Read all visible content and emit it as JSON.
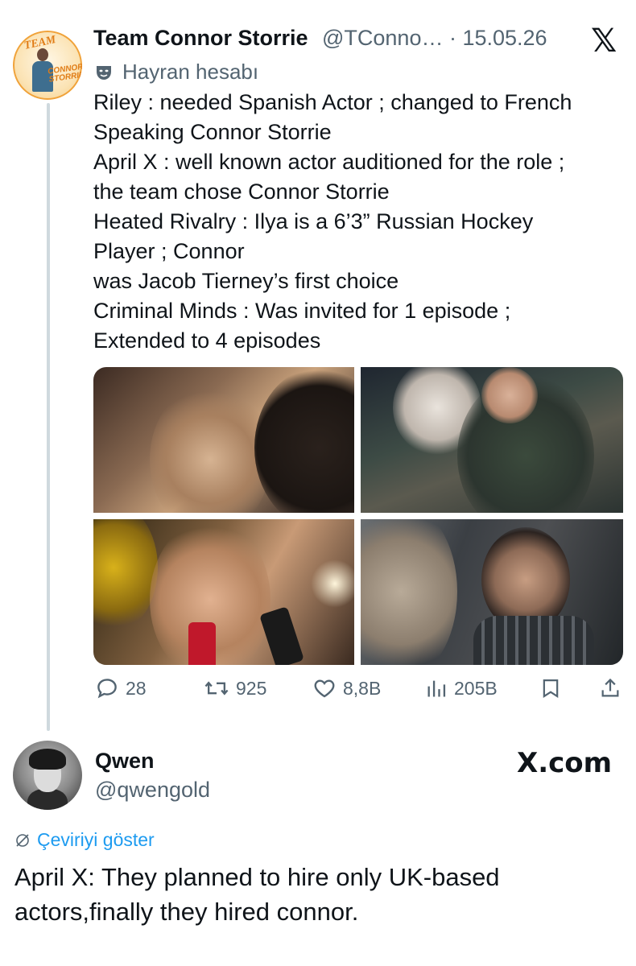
{
  "tweet": {
    "author_name": "Team Connor Storrie",
    "author_handle": "@TConno…",
    "date": "15.05.26",
    "handle_date": "@TConno… · 15.05.26",
    "badge_label": "Hayran hesabı",
    "avatar_text_top": "TEAM",
    "avatar_text_bottom": "CONNOR STORRIE",
    "text_lines": [
      "Riley : needed Spanish Actor ; changed to French",
      "Speaking Connor Storrie",
      "April X : well known actor auditioned for the role ;",
      "the team chose Connor Storrie",
      "Heated Rivalry : Ilya is a 6’3” Russian Hockey",
      "Player ; Connor",
      "was Jacob Tierney’s first choice",
      "Criminal Minds : Was invited for 1 episode ;",
      "Extended to 4 episodes"
    ],
    "media_count": 4,
    "actions": {
      "replies": "28",
      "reposts": "925",
      "likes": "8,8B",
      "views": "205B"
    }
  },
  "reply": {
    "author_name": "Qwen",
    "author_handle": "@qwengold",
    "site_label": "X.com",
    "translate_label": "Çeviriyi göster",
    "text": "April X: They planned to hire only UK-based actors,finally they hired connor."
  },
  "colors": {
    "link_blue": "#1d9bf0",
    "muted_gray": "#536471",
    "text_black": "#0f1419",
    "thread_line": "#cfd9de"
  },
  "icons": [
    "x-logo-icon",
    "fan-mask-icon",
    "reply-icon",
    "repost-icon",
    "like-icon",
    "views-icon",
    "bookmark-icon",
    "share-icon",
    "translate-icon"
  ]
}
